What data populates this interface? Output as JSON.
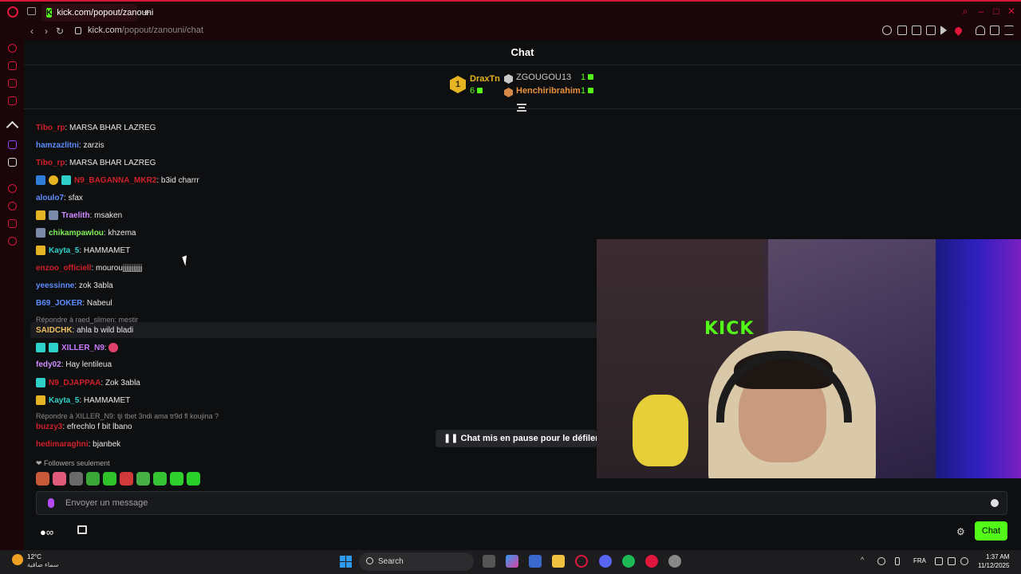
{
  "browser": {
    "tab_title": "kick.com/popout/zanouni",
    "url_host": "kick.com",
    "url_path": "/popout/zanouni/chat"
  },
  "chat": {
    "header": "Chat",
    "leaderboard": {
      "first": {
        "rank": "1",
        "name": "DraxTn",
        "count": "6"
      },
      "second": {
        "name": "ZGOUGOU13",
        "count": "1"
      },
      "third": {
        "name": "Henchiribrahim",
        "count": "1"
      }
    },
    "messages": [
      {
        "user": "Tibo_rp",
        "text": ": MARSA BHAR LAZREG",
        "color": "#d0202a"
      },
      {
        "user": "hamzazlitni",
        "text": ": zarzis",
        "color": "#5c8dff"
      },
      {
        "user": "Tibo_rp",
        "text": ": MARSA BHAR LAZREG",
        "color": "#d0202a"
      },
      {
        "user": "N9_BAGANNA_MKR2",
        "text": ": b3id charrr",
        "color": "#d0202a"
      },
      {
        "user": "aloulo7",
        "text": ": sfax",
        "color": "#5c8dff"
      },
      {
        "user": "Traelith",
        "text": ": msaken",
        "color": "#d28cff"
      },
      {
        "user": "chikampawlou",
        "text": ": khzema",
        "color": "#7ff05a"
      },
      {
        "user": "Kayta_5",
        "text": ": HAMMAMET",
        "color": "#2ed1c9"
      },
      {
        "user": "enzoo_officiell",
        "text": ": mouroujjjjjjjjjjj",
        "color": "#d0202a"
      },
      {
        "user": "yeessinne",
        "text": ": zok 3abla",
        "color": "#5c8dff"
      },
      {
        "user": "B69_JOKER",
        "text": ": Nabeul",
        "color": "#5c8dff"
      },
      {
        "user": "SAIDCHK",
        "text": ": ahla b wild bladi",
        "color": "#f0c060"
      },
      {
        "user": "XILLER_N9",
        "text": ": ",
        "color": "#c87aff"
      },
      {
        "user": "fedy02",
        "text": ": Hay lentileua",
        "color": "#d28cff"
      },
      {
        "user": "N9_DJAPPAA",
        "text": ": Zok 3abla",
        "color": "#d0202a"
      },
      {
        "user": "Kayta_5",
        "text": ": HAMMAMET",
        "color": "#2ed1c9"
      },
      {
        "user": "buzzy3",
        "text": ": efrechlo f bit lbano",
        "color": "#d0202a"
      },
      {
        "user": "hedimaraghni",
        "text": ": bjanbek",
        "color": "#d0202a"
      }
    ],
    "replies": [
      "Répondre à raed_slimen: mestir",
      "Répondre à XILLER_N9: tji tbet 3ndi ama tr9d fl koujina ?"
    ],
    "paused_banner": "Chat mis en pause pour le défilement",
    "followers_only": "Followers seulement",
    "input_placeholder": "Envoyer un message",
    "send_label": "Chat"
  },
  "webcam": {
    "sign_text": "KICK"
  },
  "taskbar": {
    "temperature": "12°C",
    "condition": "سماء صافية",
    "search_label": "Search",
    "language": "FRA",
    "time": "1:37 AM",
    "date": "11/12/2025"
  }
}
